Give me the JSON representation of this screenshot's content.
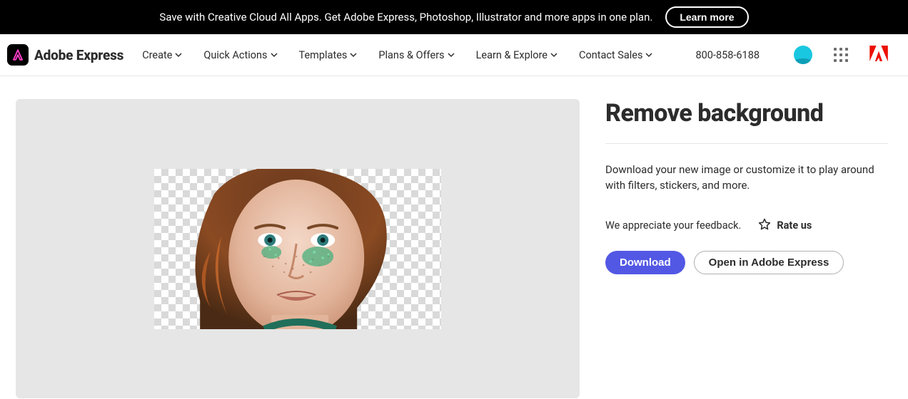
{
  "promo": {
    "text": "Save with Creative Cloud All Apps. Get Adobe Express, Photoshop, Illustrator and more apps in one plan.",
    "cta_label": "Learn more"
  },
  "brand": {
    "name": "Adobe Express"
  },
  "nav": {
    "items": [
      {
        "label": "Create"
      },
      {
        "label": "Quick Actions"
      },
      {
        "label": "Templates"
      },
      {
        "label": "Plans & Offers"
      },
      {
        "label": "Learn & Explore"
      },
      {
        "label": "Contact Sales"
      }
    ],
    "phone": "800-858-6188"
  },
  "main": {
    "title": "Remove background",
    "description": "Download your new image or customize it to play around with filters, stickers, and more.",
    "feedback_prompt": "We appreciate your feedback.",
    "rate_label": "Rate us",
    "download_label": "Download",
    "open_label": "Open in Adobe Express"
  }
}
